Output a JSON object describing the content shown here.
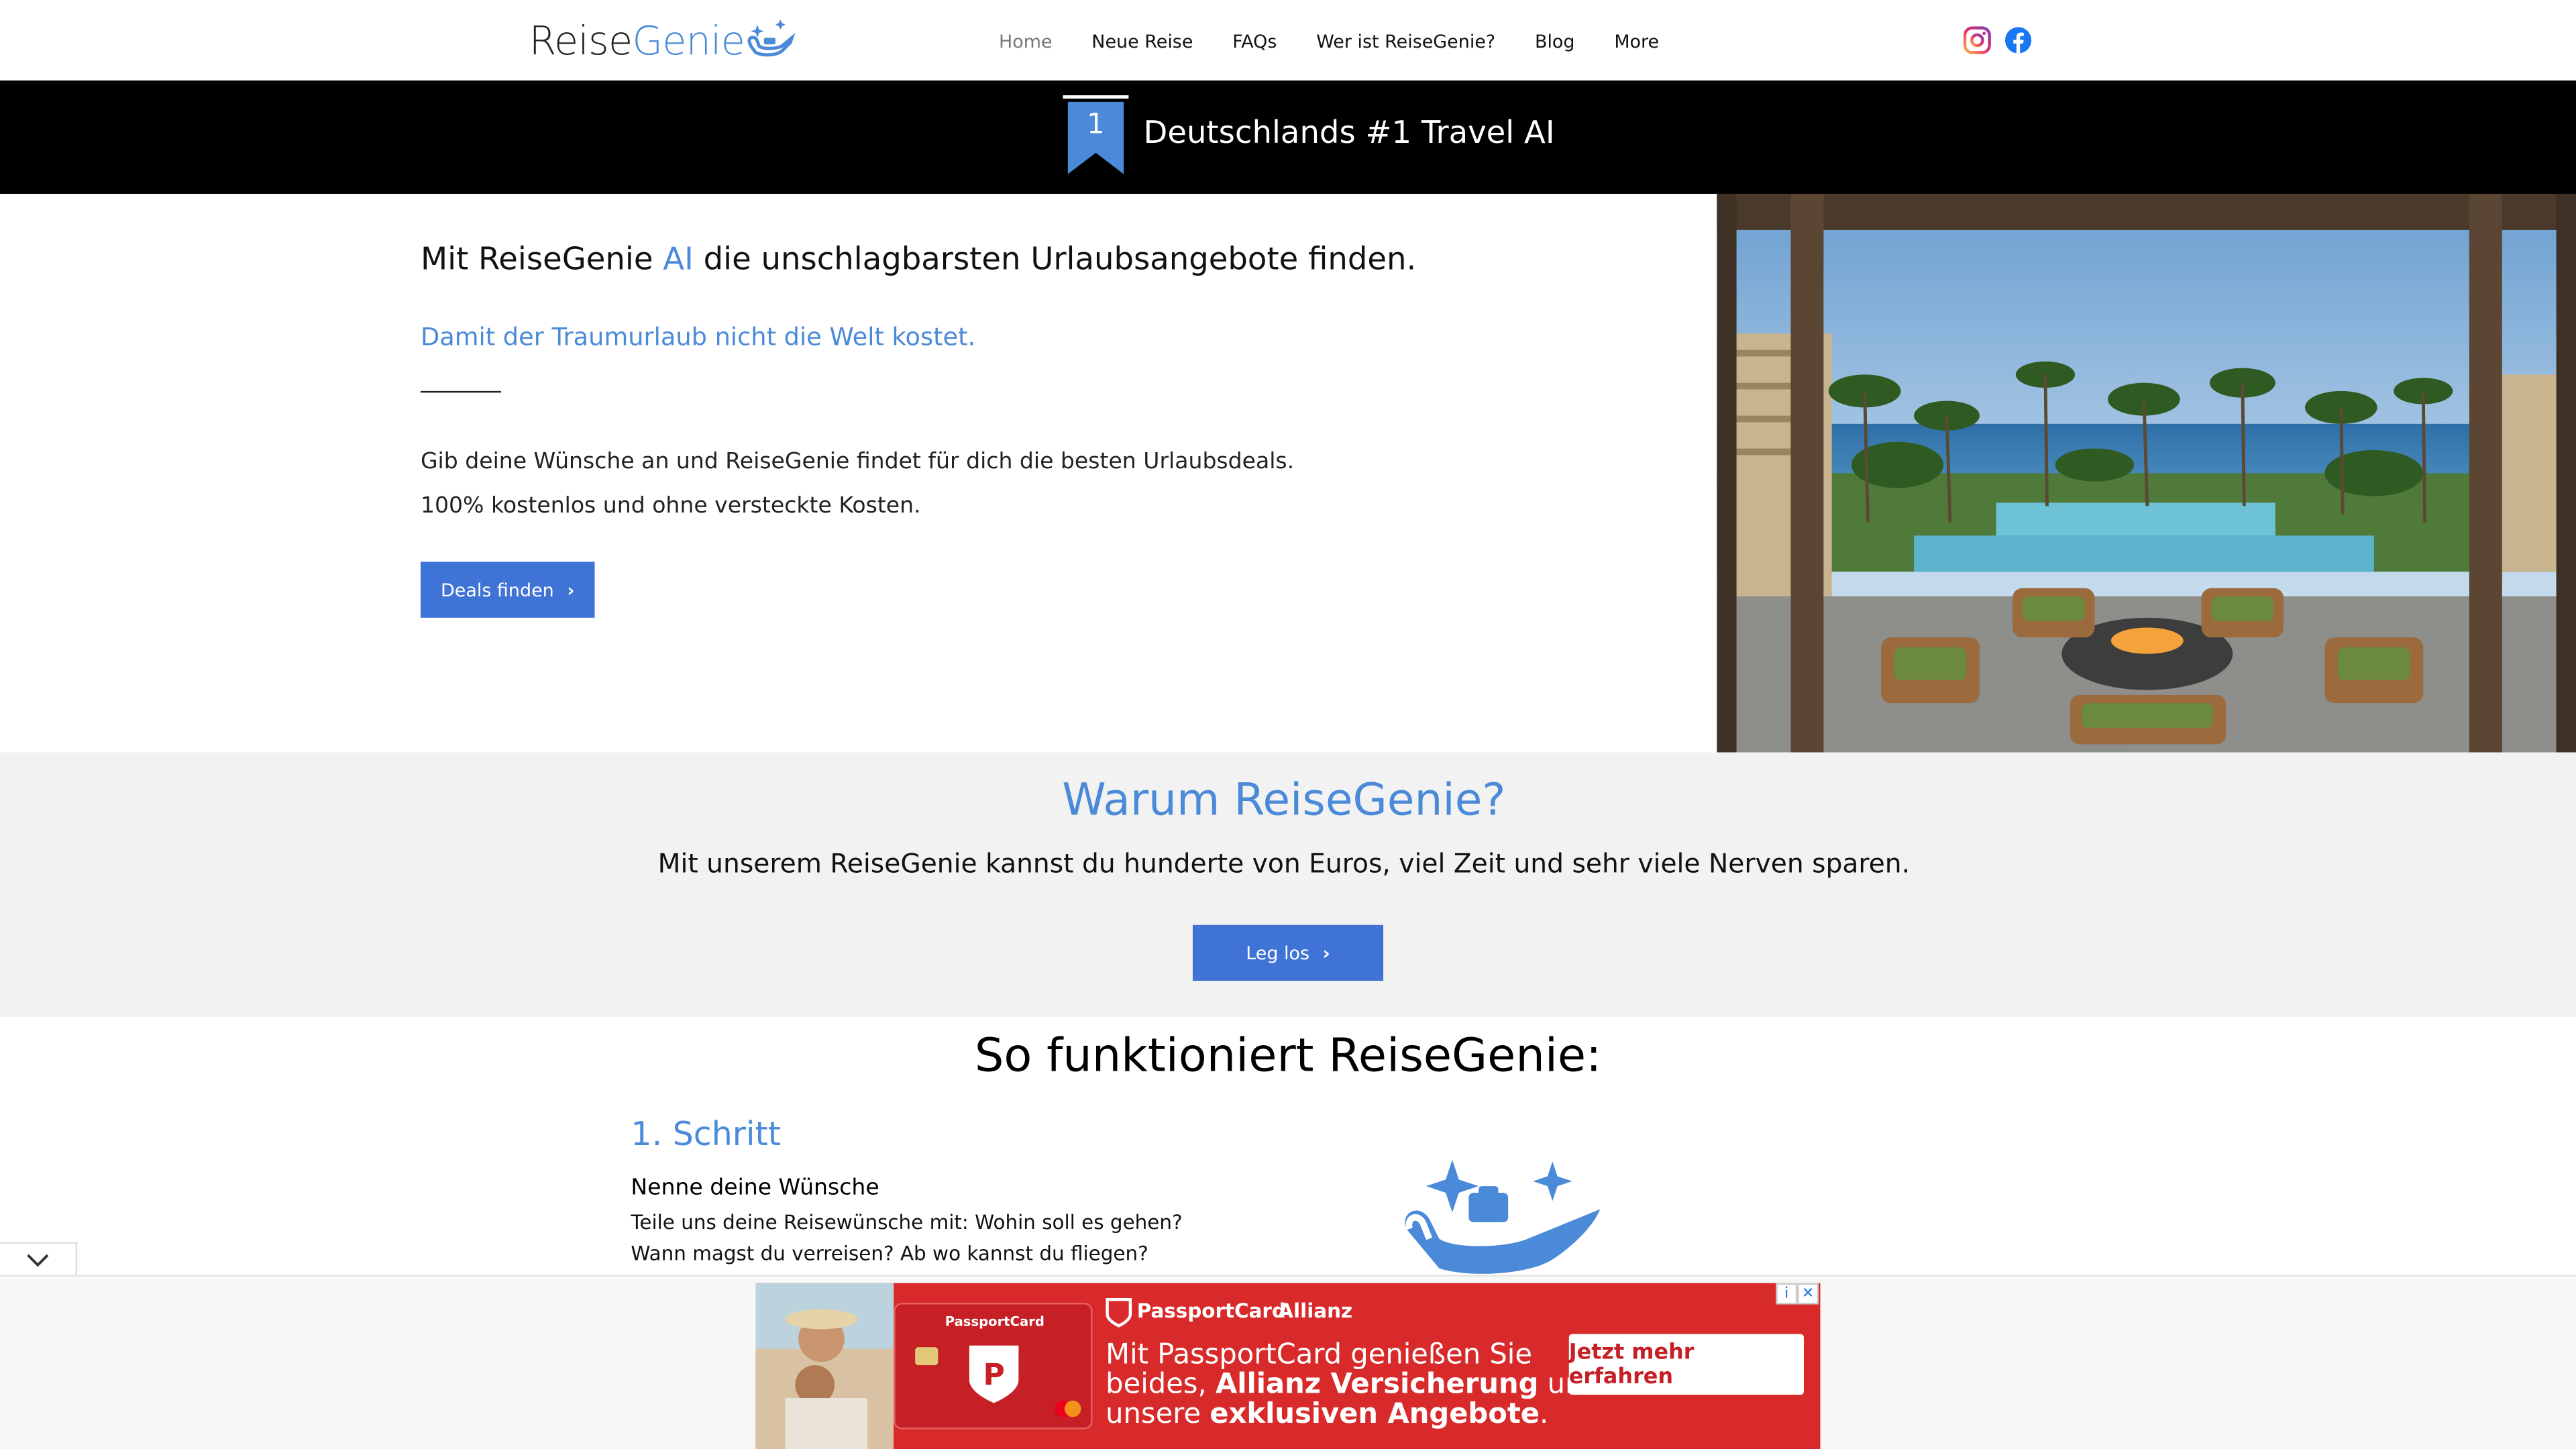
{
  "header": {
    "logo_part1": "Reise",
    "logo_part2": "Genie",
    "nav": [
      "Home",
      "Neue Reise",
      "FAQs",
      "Wer ist ReiseGenie?",
      "Blog",
      "More"
    ],
    "active_nav": "Home",
    "social_icons": [
      "instagram-icon",
      "facebook-icon"
    ]
  },
  "banner": {
    "badge_number": "1",
    "text": "Deutschlands #1 Travel AI"
  },
  "hero": {
    "title_pre": "Mit ReiseGenie ",
    "title_ai": "AI",
    "title_post": " die unschlagbarsten Urlaubsangebote finden.",
    "subtitle": "Damit der Traumurlaub nicht die Welt kostet.",
    "body_line1": "Gib deine Wünsche an und ReiseGenie findet für dich die besten Urlaubsdeals.",
    "body_line2": "100% kostenlos und ohne versteckte Kosten.",
    "button": "Deals finden"
  },
  "warum": {
    "title": "Warum ReiseGenie?",
    "text": "Mit unserem ReiseGenie kannst du hunderte von Euros, viel Zeit und sehr viele Nerven sparen.",
    "button": "Leg los"
  },
  "how": {
    "title": "So funktioniert ReiseGenie:",
    "step_number": "1. Schritt",
    "step_heading": "Nenne deine Wünsche",
    "step_line1": "Teile uns deine Reisewünsche mit: Wohin soll es gehen?",
    "step_line2": "Wann magst du verreisen? Ab wo kannst du fliegen?"
  },
  "ad": {
    "card_brand": "PassportCard",
    "brand": "PassportCard",
    "partner": "Allianz",
    "line1": "Mit PassportCard genießen Sie",
    "line2_pre": "beides, ",
    "line2_bold": "Allianz Versicherung",
    "line2_post": " und",
    "line3_pre": "unsere ",
    "line3_bold": "exklusiven Angebote",
    "line3_post": ".",
    "cta": "Jetzt mehr erfahren"
  },
  "colors": {
    "accent": "#4a8ad8",
    "button": "#4073d6",
    "banner_bg": "#000000",
    "ad_red": "#d82a2a"
  }
}
